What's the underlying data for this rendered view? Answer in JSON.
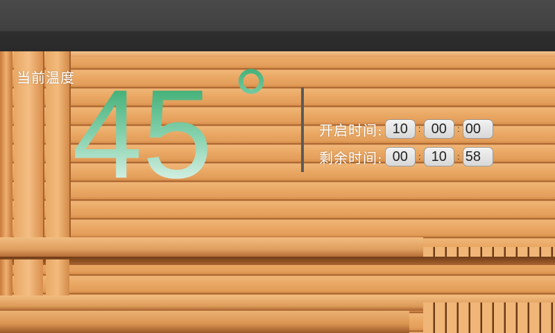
{
  "display": {
    "temp_label": "当前温度",
    "temperature": "45",
    "degree_symbol": "°"
  },
  "start_time": {
    "label": "开启时间:",
    "hours": "10",
    "minutes": "00",
    "seconds": "00"
  },
  "remaining_time": {
    "label": "剩余时间:",
    "hours": "00",
    "minutes": "10",
    "seconds": "58"
  },
  "separator": ":",
  "colors": {
    "temp_gradient_top": "#1e9e5a",
    "temp_gradient_bottom": "#ffffff",
    "label_text": "#ffffff",
    "divider": "#5a5a5a",
    "topbar": "#404040"
  }
}
